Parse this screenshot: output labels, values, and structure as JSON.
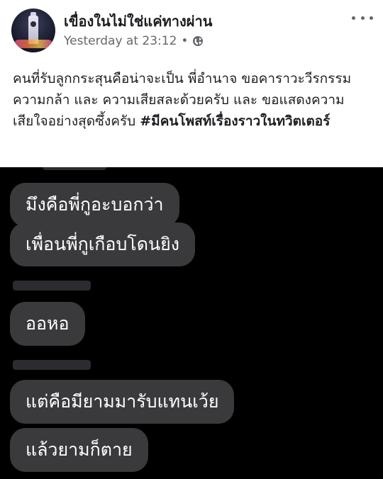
{
  "post": {
    "page_name": "เขื่องในไม่ใช่แค่ทางผ่าน",
    "timestamp": "Yesterday at 23:12",
    "separator": "•",
    "privacy_icon": "globe-icon",
    "more_icon": "more-horizontal-icon",
    "caption_text": "คนที่รับลูกกระสุนคือน่าจะเป็น พี่อำนาจ ขอคาราวะวีรกรรม ความกล้า และ ความเสียสละด้วยครับ  และ ขอแสดงความเสียใจอย่างสุดซึ้งครับ ",
    "caption_hashtag": "#มีคนโพสท์เรื่องราวในทวิตเตอร์"
  },
  "chat": {
    "messages": [
      "มึงคือพี่กูอะบอกว่า",
      "เพื่อนพี่กูเกือบโดนยิง",
      "ออหอ",
      "แต่คือมียามมารับแทนเว้ย",
      "แล้วยามก็ตาย"
    ]
  },
  "colors": {
    "text_primary": "#1c1e21",
    "text_secondary": "#65676b",
    "chat_background": "#000000",
    "bubble": "#3a3a3c",
    "redaction": "#2a2c30"
  }
}
